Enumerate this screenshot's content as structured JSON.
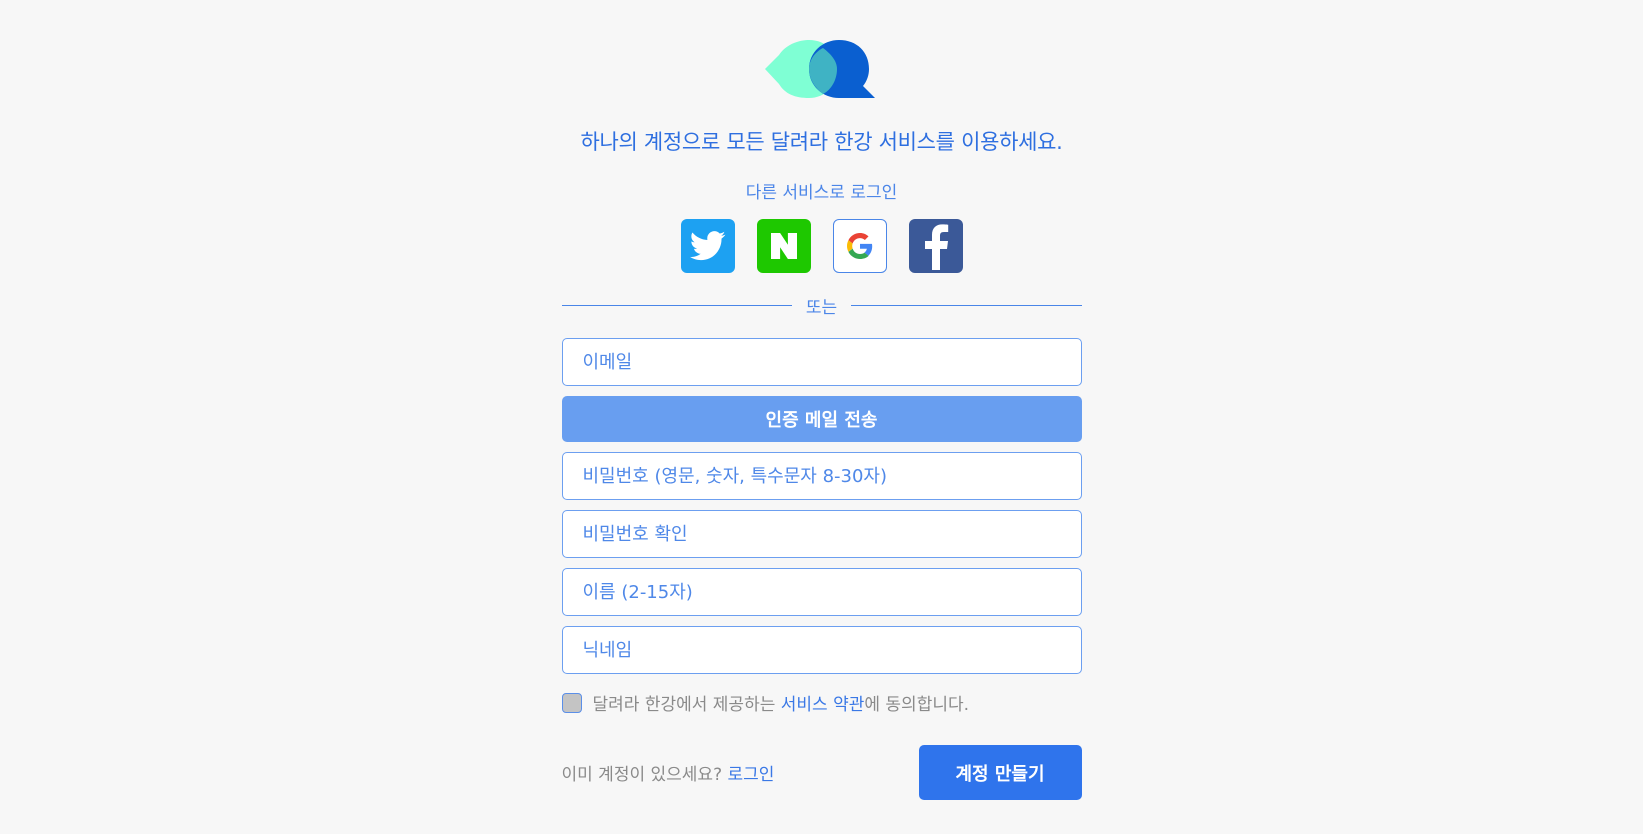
{
  "brand": {
    "logo_icon": "speech-bubbles-logo-icon",
    "colors": {
      "bubble_left": "#7fffd4",
      "bubble_right": "#0a5fd0",
      "overlap": "#3fb3c4"
    }
  },
  "headline": "하나의 계정으로 모든 달려라 한강 서비스를 이용하세요.",
  "social": {
    "label": "다른 서비스로 로그인",
    "providers": [
      {
        "name": "twitter",
        "icon": "twitter-bird-icon",
        "color": "#1da1f2"
      },
      {
        "name": "naver",
        "icon": "naver-n-icon",
        "color": "#1ec800"
      },
      {
        "name": "google",
        "icon": "google-g-icon",
        "color": "#ffffff"
      },
      {
        "name": "facebook",
        "icon": "facebook-f-icon",
        "color": "#3b5998"
      }
    ]
  },
  "divider_text": "또는",
  "form": {
    "email_placeholder": "이메일",
    "verify_button": "인증 메일 전송",
    "password_placeholder": "비밀번호 (영문, 숫자, 특수문자 8-30자)",
    "password_confirm_placeholder": "비밀번호 확인",
    "name_placeholder": "이름 (2-15자)",
    "nickname_placeholder": "닉네임"
  },
  "agreement": {
    "prefix": "달려라 한강에서 제공하는 ",
    "link": "서비스 약관",
    "suffix": "에 동의합니다."
  },
  "footer": {
    "already_text": "이미 계정이 있으세요? ",
    "login_link": "로그인",
    "create_button": "계정 만들기"
  }
}
